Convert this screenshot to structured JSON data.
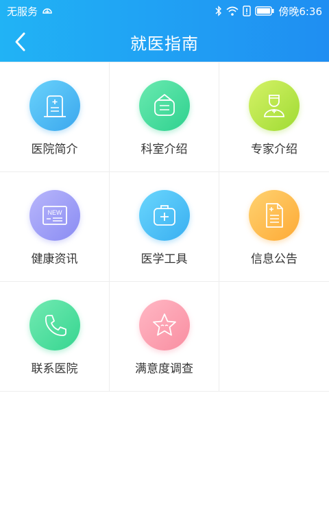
{
  "status_bar": {
    "carrier": "无服务",
    "time": "傍晚6:36"
  },
  "header": {
    "title": "就医指南",
    "back_icon": "chevron-left-icon"
  },
  "colors": {
    "header_start": "#21b3f5",
    "header_end": "#1f8ef2",
    "label": "#333333",
    "divider": "#ededed"
  },
  "menu": [
    {
      "label": "医院简介",
      "icon": "hospital-document-icon",
      "gradient": [
        "#69d2fb",
        "#3ba7ee"
      ]
    },
    {
      "label": "科室介绍",
      "icon": "department-sign-icon",
      "gradient": [
        "#6aeab0",
        "#2fd18f"
      ]
    },
    {
      "label": "专家介绍",
      "icon": "doctor-icon",
      "gradient": [
        "#d5f267",
        "#9fdb33"
      ]
    },
    {
      "label": "健康资讯",
      "icon": "news-icon",
      "gradient": [
        "#b8b6fb",
        "#8a8cf3"
      ]
    },
    {
      "label": "医学工具",
      "icon": "medical-kit-icon",
      "gradient": [
        "#6ad6fd",
        "#39aff1"
      ]
    },
    {
      "label": "信息公告",
      "icon": "notice-document-icon",
      "gradient": [
        "#ffd271",
        "#fdaa35"
      ]
    },
    {
      "label": "联系医院",
      "icon": "phone-icon",
      "gradient": [
        "#72eab2",
        "#36d590"
      ]
    },
    {
      "label": "满意度调查",
      "icon": "star-icon",
      "gradient": [
        "#ffb7c4",
        "#f98ea1"
      ]
    }
  ]
}
